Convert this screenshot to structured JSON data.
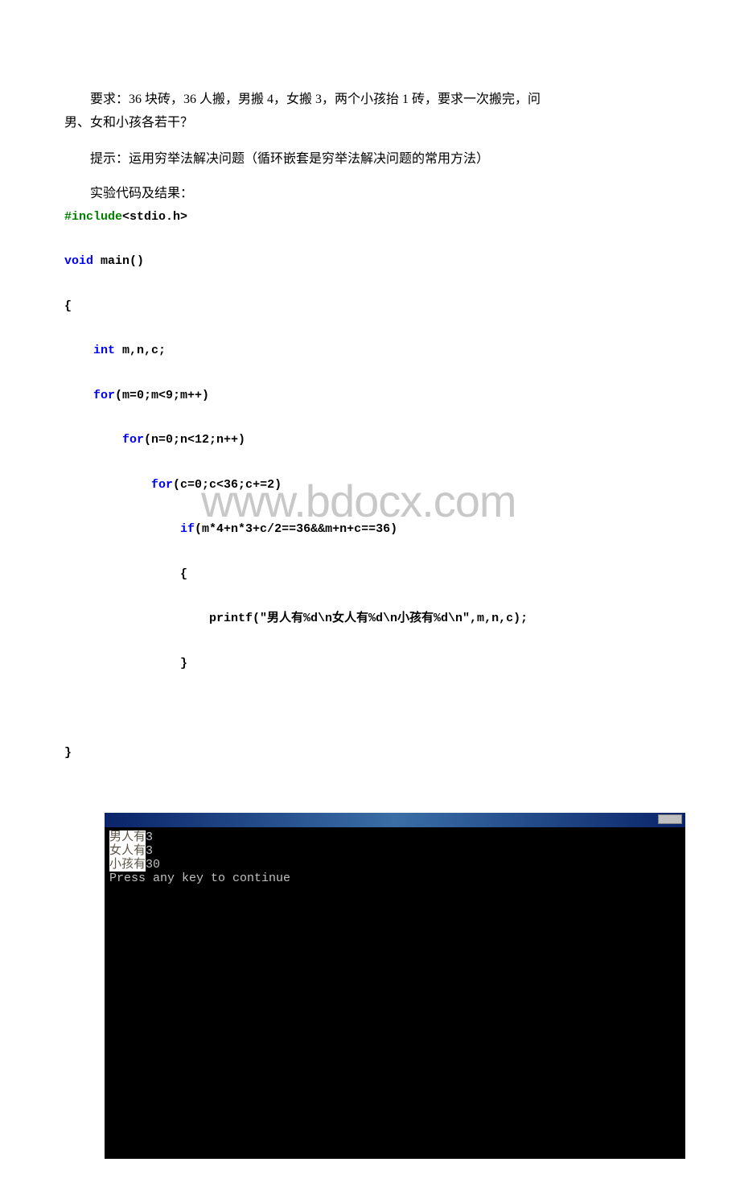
{
  "problem": {
    "line1": "要求：36 块砖，36 人搬，男搬 4，女搬 3，两个小孩抬 1 砖，要求一次搬完，问",
    "line2": "男、女和小孩各若干？",
    "hint": "提示：运用穷举法解决问题（循环嵌套是穷举法解决问题的常用方法）",
    "code_label": "实验代码及结果："
  },
  "code": {
    "l01_kw": "#include",
    "l01_rest": "<stdio.h>",
    "l02": "",
    "l03_kw": "void",
    "l03_rest": " main()",
    "l04": "",
    "l05": "{",
    "l06": "",
    "l07_pre": "    ",
    "l07_kw": "int",
    "l07_rest": " m,n,c;",
    "l08": "",
    "l09_pre": "    ",
    "l09_kw": "for",
    "l09_rest": "(m=0;m<9;m++)",
    "l10": "",
    "l11_pre": "        ",
    "l11_kw": "for",
    "l11_rest": "(n=0;n<12;n++)",
    "l12": "",
    "l13_pre": "            ",
    "l13_kw": "for",
    "l13_rest": "(c=0;c<36;c+=2)",
    "l14": "",
    "l15_pre": "                ",
    "l15_kw": "if",
    "l15_rest": "(m*4+n*3+c/2==36&&m+n+c==36)",
    "l16": "",
    "l17": "                {",
    "l18": "",
    "l19": "                    printf(\"男人有%d\\n女人有%d\\n小孩有%d\\n\",m,n,c);",
    "l20": "",
    "l21": "                }",
    "l22": "",
    "l23": "",
    "l24": "",
    "l25": "}"
  },
  "watermark": "www.bdocx.com",
  "terminal": {
    "out1_a": "男人有",
    "out1_b": "3",
    "out2_a": "女人有",
    "out2_b": "3",
    "out3_a": "小孩有",
    "out3_b": "30",
    "out4": "Press any key to continue"
  }
}
